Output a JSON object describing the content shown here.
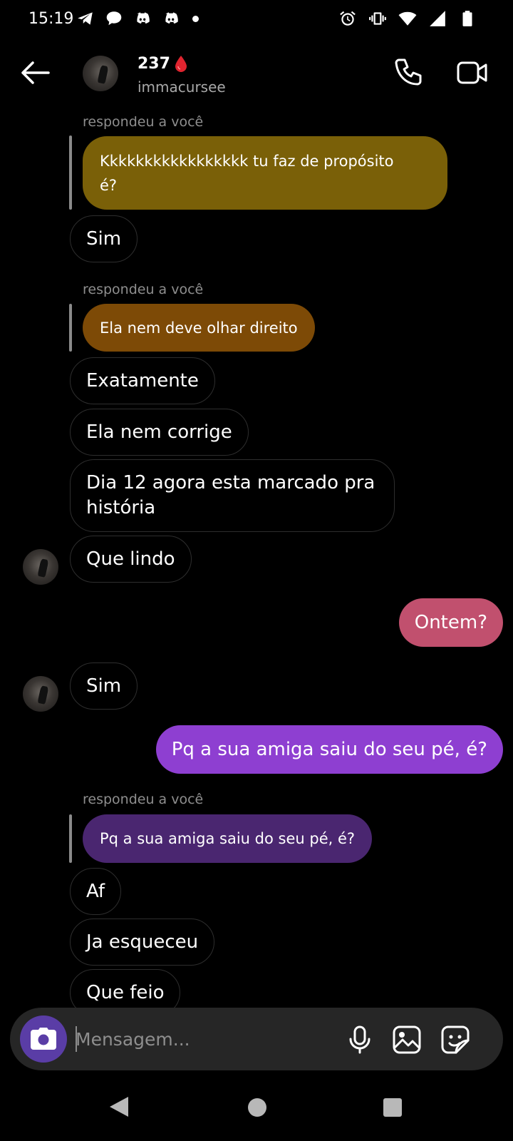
{
  "status_bar": {
    "time": "15:19"
  },
  "header": {
    "contact_name": "237",
    "contact_handle": "immacursee"
  },
  "messages": [
    {
      "type": "reply_caption",
      "text": "respondeu a você"
    },
    {
      "type": "quoted",
      "text_line1": "Kkkkkkkkkkkkkkkkk tu faz de propósito",
      "text_line2": "é?",
      "color": "#7a6008"
    },
    {
      "type": "received",
      "text": "Sim"
    },
    {
      "type": "reply_caption",
      "text": "respondeu a você"
    },
    {
      "type": "quoted",
      "text": "Ela nem deve olhar direito",
      "color": "#7d4a06"
    },
    {
      "type": "received",
      "text": "Exatamente"
    },
    {
      "type": "received",
      "text": "Ela nem corrige"
    },
    {
      "type": "received",
      "text_line1": "Dia 12 agora esta marcado pra",
      "text_line2": "história"
    },
    {
      "type": "received",
      "text": "Que lindo"
    },
    {
      "type": "sent",
      "text": "Ontem?",
      "color": "#c1506e"
    },
    {
      "type": "received",
      "text": "Sim"
    },
    {
      "type": "sent",
      "text": "Pq a sua amiga saiu do seu pé, é?",
      "color": "#8e3fd1"
    },
    {
      "type": "reply_caption",
      "text": "respondeu a você"
    },
    {
      "type": "quoted",
      "text": "Pq a sua amiga saiu do seu pé, é?",
      "color": "#4a2670"
    },
    {
      "type": "received",
      "text": "Af"
    },
    {
      "type": "received",
      "text": "Ja esqueceu"
    },
    {
      "type": "received",
      "text": "Que feio"
    }
  ],
  "composer": {
    "placeholder": "Mensagem..."
  },
  "icons": {
    "back": "arrow-left-icon",
    "call": "phone-icon",
    "video": "video-camera-icon",
    "camera": "camera-icon",
    "mic": "microphone-icon",
    "gallery": "image-icon",
    "sticker": "sticker-icon"
  }
}
